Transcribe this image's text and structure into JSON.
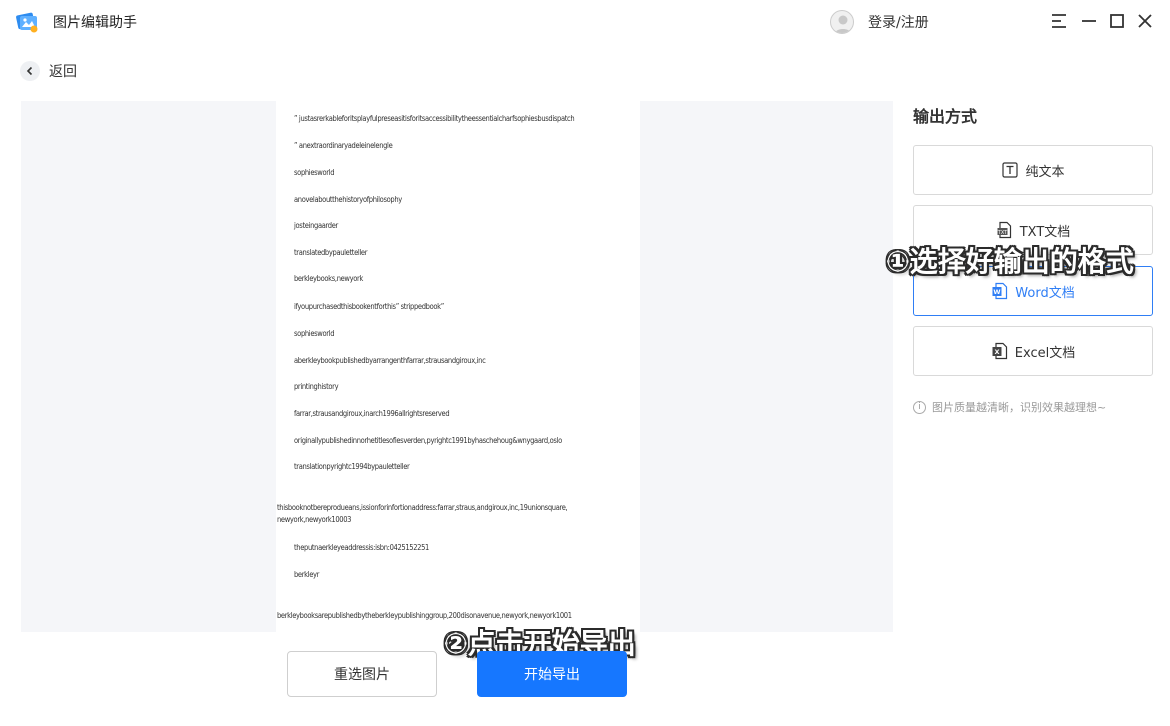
{
  "app": {
    "title": "图片编辑助手"
  },
  "header": {
    "login_label": "登录/注册"
  },
  "nav": {
    "back_label": "返回"
  },
  "preview": {
    "lines": [
      "” justasrerkableforitsplayfulpreseasitisforitsaccessibilitytheessentialcharfsophiesbusdispatch",
      "” anextraordinaryadeleinelengle",
      "sophiesworld",
      "anovelaboutthehistoryofphilosophy",
      "josteingaarder",
      "translatedbypauletteller",
      "berkleybooks,newyork",
      "ifyoupurchasedthisbookentforthis” strippedbook”",
      "sophiesworld",
      "aberkleybookpublishedbyarrangenthfarrar,strausandgiroux,inc",
      "printinghistory",
      "farrar,strausandgiroux,inarch1996allrightsreserved",
      "originallypublishedinnorhetitlesofiesverden,pyrightc1991byhaschehoug&wnygaard,oslo",
      "translationpyrightc1994bypauletteller",
      "thisbooknotbereprodueans,issionforinfortionaddress:farrar,straus,andgiroux,inc,19unionsquare, newyork,newyork10003",
      "theputnaerkleyeaddressis:isbn:0425152251",
      "berkleyr",
      "berkleybooksarepublishedbytheberkleypublishinggroup,200disonavenue,newyork,newyork1001"
    ]
  },
  "output": {
    "title": "输出方式",
    "options": [
      {
        "label": "纯文本",
        "icon": "text-icon"
      },
      {
        "label": "TXT文档",
        "icon": "txt-file-icon"
      },
      {
        "label": "Word文档",
        "icon": "word-file-icon",
        "selected": true
      },
      {
        "label": "Excel文档",
        "icon": "excel-file-icon"
      }
    ],
    "tip": "图片质量越清晰，识别效果越理想~"
  },
  "buttons": {
    "reselect_label": "重选图片",
    "export_label": "开始导出"
  },
  "annotations": {
    "step1": "①选择好输出的格式",
    "step2": "②点击开始导出"
  },
  "colors": {
    "accent": "#1677ff",
    "selected_border": "#2f7ef5"
  }
}
